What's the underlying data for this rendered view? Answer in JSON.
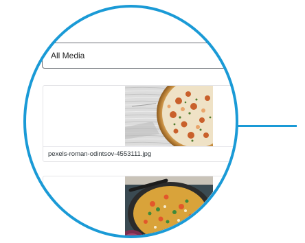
{
  "filter": {
    "label": "All Media"
  },
  "media_items": [
    {
      "filename": "pexels-roman-odintsov-4553111.jpg",
      "thumbnail": "pizza-photo"
    },
    {
      "filename": "",
      "thumbnail": "paella-photo"
    }
  ],
  "colors": {
    "accent": "#1a9ad6",
    "border": "#6b6f75",
    "card_border": "#e4e4e7",
    "text": "#1e1e1e"
  }
}
